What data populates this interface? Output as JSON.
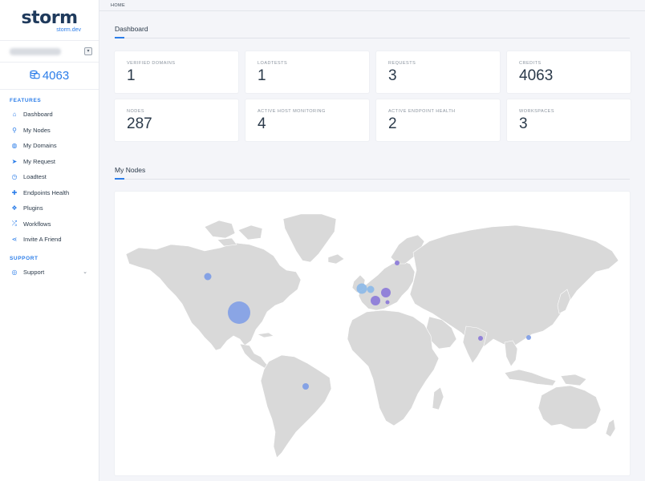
{
  "brand": {
    "name": "storm",
    "subtitle": "storm.dev"
  },
  "account": {
    "toggle_icon": "chevron-down-icon"
  },
  "credits": {
    "value": "4063",
    "icon": "coins-icon"
  },
  "sidebar": {
    "features_label": "FEATURES",
    "support_label": "SUPPORT",
    "items": [
      {
        "label": "Dashboard",
        "icon": "home-icon",
        "glyph": "⌂"
      },
      {
        "label": "My Nodes",
        "icon": "sitemap-icon",
        "glyph": "⚲"
      },
      {
        "label": "My Domains",
        "icon": "globe-icon",
        "glyph": "◍"
      },
      {
        "label": "My Request",
        "icon": "rocket-icon",
        "glyph": "➤"
      },
      {
        "label": "Loadtest",
        "icon": "clock-icon",
        "glyph": "◷"
      },
      {
        "label": "Endpoints Health",
        "icon": "medkit-icon",
        "glyph": "✚"
      },
      {
        "label": "Plugins",
        "icon": "cubes-icon",
        "glyph": "❖"
      },
      {
        "label": "Workflows",
        "icon": "random-icon",
        "glyph": "⤮"
      },
      {
        "label": "Invite A Friend",
        "icon": "share-icon",
        "glyph": "⋖"
      }
    ],
    "support_items": [
      {
        "label": "Support",
        "icon": "life-ring-icon",
        "glyph": "◎"
      }
    ]
  },
  "breadcrumb": {
    "home": "HOME"
  },
  "dashboard": {
    "title": "Dashboard",
    "cards": [
      {
        "label": "VERIFIED DOMAINS",
        "value": "1"
      },
      {
        "label": "LOADTESTS",
        "value": "1"
      },
      {
        "label": "REQUESTS",
        "value": "3"
      },
      {
        "label": "CREDITS",
        "value": "4063"
      },
      {
        "label": "NODES",
        "value": "287"
      },
      {
        "label": "ACTIVE HOST MONITORING",
        "value": "4"
      },
      {
        "label": "ACTIVE ENDPOINT HEALTH",
        "value": "2"
      },
      {
        "label": "WORKSPACES",
        "value": "3"
      }
    ]
  },
  "nodes": {
    "title": "My Nodes",
    "land_color": "#d9d9d9",
    "bubble_color_blue": "#7b9be6",
    "bubble_color_purple": "#8a78d8",
    "bubble_color_light": "#8bb8e8"
  }
}
